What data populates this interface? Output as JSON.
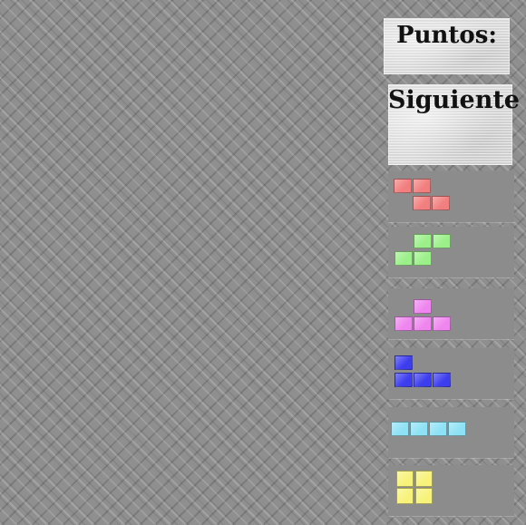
{
  "score_panel": {
    "title": "Puntos:"
  },
  "next_panel": {
    "title": "Siguiente"
  },
  "pieces": [
    {
      "name": "Z",
      "color": "#f27f7f",
      "cells": [
        [
          0,
          0
        ],
        [
          1,
          0
        ],
        [
          1,
          1
        ],
        [
          2,
          1
        ]
      ]
    },
    {
      "name": "S",
      "color": "#9cf08a",
      "cells": [
        [
          1,
          0
        ],
        [
          2,
          0
        ],
        [
          0,
          1
        ],
        [
          1,
          1
        ]
      ]
    },
    {
      "name": "T",
      "color": "#ef86ef",
      "cells": [
        [
          1,
          0
        ],
        [
          0,
          1
        ],
        [
          1,
          1
        ],
        [
          2,
          1
        ]
      ]
    },
    {
      "name": "J",
      "color": "#3d3df0",
      "cells": [
        [
          0,
          0
        ],
        [
          0,
          1
        ],
        [
          1,
          1
        ],
        [
          2,
          1
        ]
      ]
    },
    {
      "name": "I",
      "color": "#8fe2f5",
      "cells": [
        [
          0,
          0
        ],
        [
          1,
          0
        ],
        [
          2,
          0
        ],
        [
          3,
          0
        ]
      ]
    },
    {
      "name": "O",
      "color": "#f7f37a",
      "cells": [
        [
          0,
          0
        ],
        [
          1,
          0
        ],
        [
          0,
          1
        ],
        [
          1,
          1
        ]
      ]
    }
  ]
}
